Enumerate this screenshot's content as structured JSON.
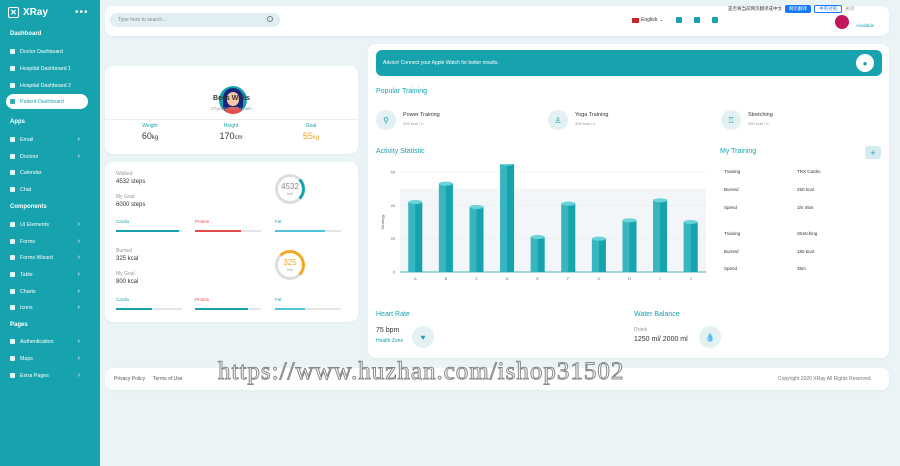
{
  "app": {
    "title": "XRay"
  },
  "sidebar": {
    "sections": [
      "Dashboard",
      "Apps",
      "Components",
      "Pages"
    ],
    "items": [
      {
        "label": "Doctor Dashboard"
      },
      {
        "label": "Hospital Dashboard 1"
      },
      {
        "label": "Hospital Dashboard 2"
      },
      {
        "label": "Patient Dashboard"
      },
      {
        "label": "Email"
      },
      {
        "label": "Doctors"
      },
      {
        "label": "Calendar"
      },
      {
        "label": "Chat"
      },
      {
        "label": "UI Elements"
      },
      {
        "label": "Forms"
      },
      {
        "label": "Forms Wizard"
      },
      {
        "label": "Table"
      },
      {
        "label": "Charts"
      },
      {
        "label": "Icons"
      },
      {
        "label": "Authentication"
      },
      {
        "label": "Maps"
      },
      {
        "label": "Extra Pages"
      }
    ]
  },
  "topbar": {
    "search_placeholder": "Type here to search...",
    "language": "English",
    "user_status": "Available",
    "translate_text": "是否将当前网页翻译成中文",
    "translate_btn": "网页翻译",
    "translate_btn2": "中英对照",
    "translate_close": "关闭"
  },
  "profile": {
    "name": "Bess Willis",
    "subtitle": "27years Old/Female",
    "stats": [
      {
        "label": "Weight",
        "value": "60",
        "unit": "kg"
      },
      {
        "label": "Height",
        "value": "170",
        "unit": "cm"
      },
      {
        "label": "Goal",
        "value": "55",
        "unit": "kg"
      }
    ]
  },
  "steps": {
    "walked_label": "Walked",
    "walked_value": "4532 steps",
    "goal_label": "My Goal",
    "goal_value": "6000 steps",
    "ring_value": "4532",
    "ring_unit": "left",
    "bars": [
      {
        "label": "Cardio",
        "pct": 0.95,
        "color": "#16a3ad"
      },
      {
        "label": "Protein",
        "pct": 0.7,
        "color": "#e64a4a"
      },
      {
        "label": "Fat",
        "pct": 0.75,
        "color": "#4fc3d9"
      }
    ]
  },
  "calories": {
    "burned_label": "Burned",
    "burned_value": "325 kcal",
    "goal_label": "My Goal",
    "goal_value": "800 kcal",
    "ring_value": "325",
    "ring_unit": "left",
    "bars": [
      {
        "label": "Cardio",
        "pct": 0.55,
        "color": "#16a3ad"
      },
      {
        "label": "Protein",
        "pct": 0.8,
        "color": "#16a3ad"
      },
      {
        "label": "Fat",
        "pct": 0.45,
        "color": "#4fc3d9"
      }
    ]
  },
  "advice": "Advice! Connect your Apple Watch for better results.",
  "popular_training": {
    "title": "Popular Training",
    "items": [
      {
        "name": "Power Training",
        "sub": "395 kcal / h"
      },
      {
        "name": "Yoga Training",
        "sub": "395 kcal / h"
      },
      {
        "name": "Stretching",
        "sub": "395 kcal / h"
      }
    ]
  },
  "activity": {
    "title": "Activity Statistic"
  },
  "chart_data": {
    "type": "bar",
    "categories": [
      "A",
      "B",
      "C",
      "D",
      "E",
      "F",
      "G",
      "H",
      "I",
      "J"
    ],
    "values": [
      42,
      53,
      39,
      65,
      21,
      41,
      20,
      31,
      43,
      30
    ],
    "ylabel": "Strategy",
    "ylim": [
      0,
      60
    ],
    "yticks": [
      0,
      20,
      40,
      60
    ],
    "color": "#16a3ad"
  },
  "my_training": {
    "title": "My Training",
    "rows": [
      {
        "k": "Training",
        "v": "TRX Cardio"
      },
      {
        "k": "Burned",
        "v": "250 kcal"
      },
      {
        "k": "Spend",
        "v": "1hr 45m"
      },
      {
        "k": "Training",
        "v": "Stretching"
      },
      {
        "k": "Burned",
        "v": "180 kcal"
      },
      {
        "k": "Spend",
        "v": "35m"
      }
    ]
  },
  "heart_rate": {
    "title": "Heart Rate",
    "value": "75 bpm",
    "sub": "Health Zone"
  },
  "water": {
    "title": "Water Balance",
    "label": "Drank",
    "value": "1250 ml/ 2000 ml"
  },
  "footer": {
    "privacy": "Privacy Policy",
    "terms": "Terms of Use",
    "copyright": "Copyright 2020 XRay All Rights Reserved."
  },
  "watermark": "https://www.huzhan.com/ishop31502"
}
